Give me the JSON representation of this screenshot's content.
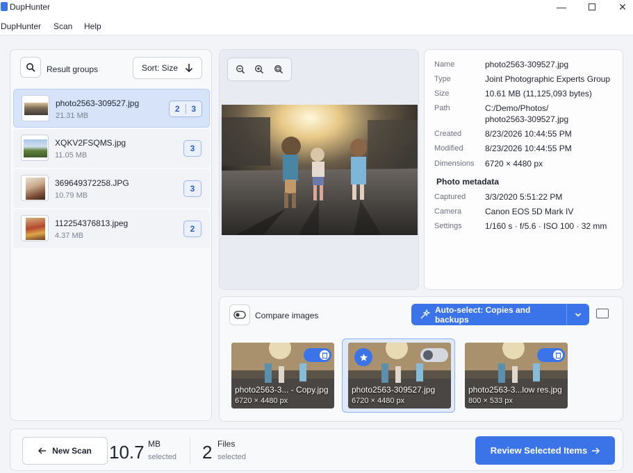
{
  "app": {
    "title": "DupHunter"
  },
  "window_controls": {
    "minimize": "—",
    "close": "✕"
  },
  "menu": [
    "DupHunter",
    "Scan",
    "Help"
  ],
  "groups_panel": {
    "title": "Result groups",
    "sort_label": "Sort: Size",
    "groups": [
      {
        "name": "photo2563-309527.jpg",
        "size": "21.31 MB",
        "counts": [
          "2",
          "3"
        ],
        "selected": true
      },
      {
        "name": "XQKV2FSQMS.jpg",
        "size": "11.05 MB",
        "counts": [
          "3"
        ]
      },
      {
        "name": "369649372258.JPG",
        "size": "10.79 MB",
        "counts": [
          "3"
        ]
      },
      {
        "name": "112254376813.jpeg",
        "size": "4.37 MB",
        "counts": [
          "2"
        ]
      }
    ]
  },
  "details": {
    "rows": [
      {
        "label": "Name",
        "value": "photo2563-309527.jpg"
      },
      {
        "label": "Type",
        "value": "Joint Photographic Experts Group"
      },
      {
        "label": "Size",
        "value": "10.61 MB (11,125,093 bytes)"
      },
      {
        "label": "Path",
        "value": "C:/Demo/Photos/",
        "value2": "photo2563-309527.jpg"
      },
      {
        "label": "Created",
        "value": "8/23/2026 10:44:55 PM"
      },
      {
        "label": "Modified",
        "value": "8/23/2026 10:44:55 PM"
      },
      {
        "label": "Dimensions",
        "value": "6720 × 4480 px"
      }
    ],
    "metadata_title": "Photo metadata",
    "metadata": [
      {
        "label": "Captured",
        "value": "3/3/2020 5:51:22 PM"
      },
      {
        "label": "Camera",
        "value": "Canon EOS 5D Mark IV"
      },
      {
        "label": "Settings",
        "value": "1/160 s · f/5.6 · ISO 100 · 32 mm"
      }
    ]
  },
  "compare": {
    "label": "Compare images",
    "auto_select_label": "Auto-select: Copies and backups",
    "items": [
      {
        "name": "photo2563-3... - Copy.jpg",
        "dims": "6720 × 4480 px",
        "marked": true
      },
      {
        "name": "photo2563-309527.jpg",
        "dims": "6720 × 4480 px",
        "marked": false,
        "original": true
      },
      {
        "name": "photo2563-3...low res.jpg",
        "dims": "800 × 533 px",
        "marked": true
      }
    ]
  },
  "footer": {
    "new_scan": "New Scan",
    "size_value": "10.7",
    "size_unit": "MB",
    "size_sub": "selected",
    "files_value": "2",
    "files_unit": "Files",
    "files_sub": "selected",
    "review": "Review Selected Items"
  },
  "colors": {
    "accent": "#3b73e8",
    "selected_row": "#d6e3f8"
  }
}
